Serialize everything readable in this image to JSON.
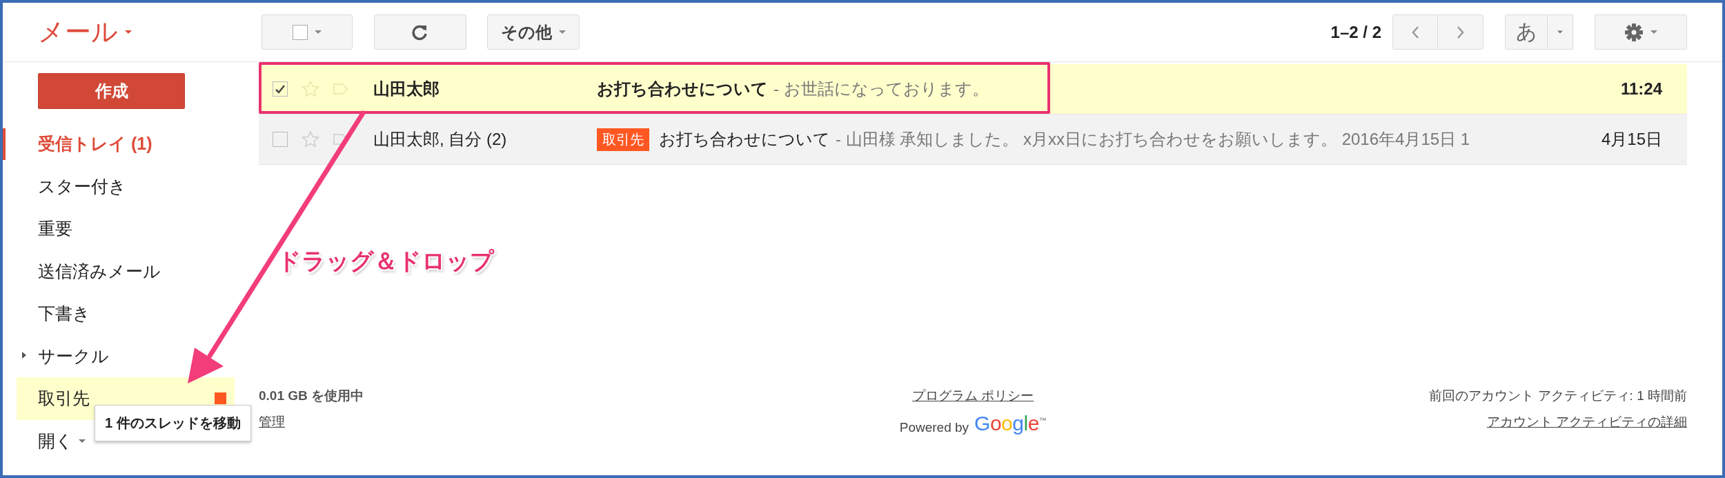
{
  "app": {
    "title": "メール"
  },
  "toolbar": {
    "select_checked": false,
    "more_label": "その他",
    "page_range": "1–2 / 2",
    "input_tool": "あ"
  },
  "sidebar": {
    "compose": "作成",
    "items": [
      {
        "label": "受信トレイ (1)",
        "kind": "folder",
        "selected": true,
        "highlighted": false
      },
      {
        "label": "スター付き",
        "kind": "folder",
        "selected": false,
        "highlighted": false
      },
      {
        "label": "重要",
        "kind": "folder",
        "selected": false,
        "highlighted": false
      },
      {
        "label": "送信済みメール",
        "kind": "folder",
        "selected": false,
        "highlighted": false
      },
      {
        "label": "下書き",
        "kind": "folder",
        "selected": false,
        "highlighted": false
      },
      {
        "label": "サークル",
        "kind": "group",
        "expanded": false,
        "selected": false,
        "highlighted": false
      },
      {
        "label": "取引先",
        "kind": "label",
        "color": "#ff5722",
        "selected": false,
        "highlighted": true
      },
      {
        "label": "開く",
        "kind": "more",
        "selected": false,
        "highlighted": false
      }
    ]
  },
  "messages": [
    {
      "sender": "山田太郎",
      "subject": "お打ち合わせについて",
      "snippet": "- お世話になっております。",
      "time": "11:24",
      "unread": true,
      "checked": true,
      "starred": false
    },
    {
      "sender": "山田太郎, 自分 (2)",
      "labels": [
        {
          "text": "取引先",
          "color": "#ff5722"
        }
      ],
      "subject": "お打ち合わせについて",
      "snippet": "- 山田様 承知しました。 x月xx日にお打ち合わせをお願いします。 2016年4月15日 1",
      "time": "4月15日",
      "unread": false,
      "checked": false,
      "starred": false
    }
  ],
  "drag": {
    "caption": "ドラッグ＆ドロップ",
    "tooltip": "1 件のスレッドを移動"
  },
  "footer": {
    "storage": "0.01 GB を使用中",
    "manage": "管理",
    "policy": "プログラム ポリシー",
    "powered_by": "Powered by",
    "logo": "Google",
    "logo_mark": "™",
    "last_activity": "前回のアカウント アクティビティ: 1 時間前",
    "details": "アカウント アクティビティの詳細"
  }
}
